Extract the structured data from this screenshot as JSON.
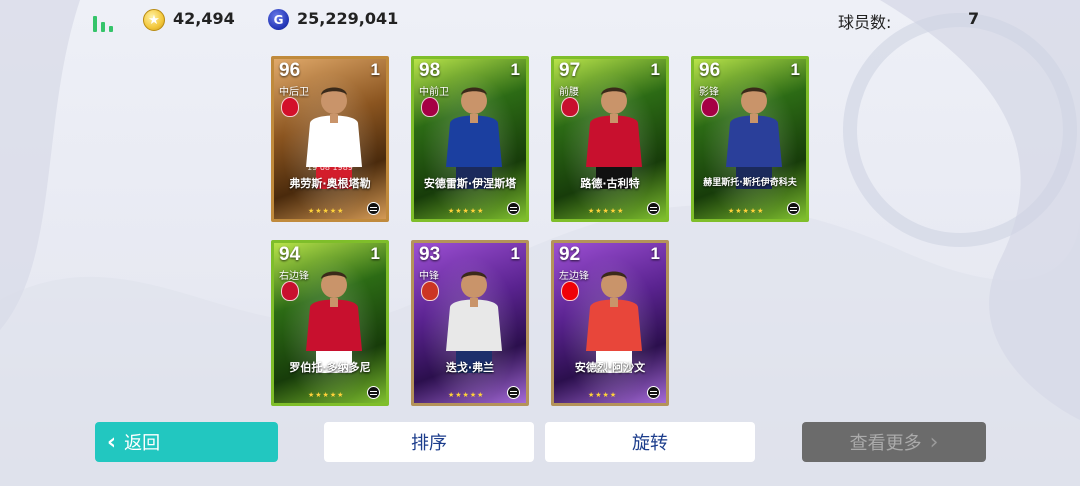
{
  "topbar": {
    "coins": "42,494",
    "gp": "25,229,041",
    "gp_icon_letter": "G",
    "player_count_label": "球员数:",
    "player_count": "7"
  },
  "cards": [
    {
      "rating": "96",
      "level": "1",
      "position": "中后卫",
      "name": "弗劳斯·奥根塔勒",
      "date": "19 08 1989",
      "stars": "★★★★★",
      "style": "bronze",
      "club_color": "#d3102a",
      "kit_top": "#ffffff",
      "kit_bottom": "#d31d2b"
    },
    {
      "rating": "98",
      "level": "1",
      "position": "中前卫",
      "name": "安德雷斯·伊涅斯塔",
      "date": "",
      "stars": "★★★★★",
      "style": "green",
      "club_color": "#a50044",
      "kit_top": "#1b3fa0",
      "kit_bottom": "#1b2a5c"
    },
    {
      "rating": "97",
      "level": "1",
      "position": "前腰",
      "name": "路德·古利特",
      "date": "",
      "stars": "★★★★★",
      "style": "green",
      "club_color": "#c8102e",
      "kit_top": "#c8102e",
      "kit_bottom": "#111111"
    },
    {
      "rating": "96",
      "level": "1",
      "position": "影锋",
      "name": "赫里斯托·斯托伊奇科夫",
      "date": "",
      "stars": "★★★★★",
      "style": "green",
      "club_color": "#a50044",
      "kit_top": "#2a3f9a",
      "kit_bottom": "#1b2a5c"
    },
    {
      "rating": "94",
      "level": "1",
      "position": "右边锋",
      "name": "罗伯托·多纳多尼",
      "date": "",
      "stars": "★★★★★",
      "style": "green",
      "club_color": "#c8102e",
      "kit_top": "#c8102e",
      "kit_bottom": "#ffffff"
    },
    {
      "rating": "93",
      "level": "1",
      "position": "中锋",
      "name": "迭戈·弗兰",
      "date": "",
      "stars": "★★★★★",
      "style": "purple",
      "club_color": "#cb3524",
      "kit_top": "#e8e8e8",
      "kit_bottom": "#1c2f6b"
    },
    {
      "rating": "92",
      "level": "1",
      "position": "左边锋",
      "name": "安德烈·阿沙文",
      "date": "",
      "stars": "★★★★",
      "style": "purple",
      "club_color": "#ef0107",
      "kit_top": "#e8463a",
      "kit_bottom": "#ffffff"
    }
  ],
  "buttons": {
    "back": "返回",
    "sort": "排序",
    "rotate": "旋转",
    "more": "查看更多"
  }
}
